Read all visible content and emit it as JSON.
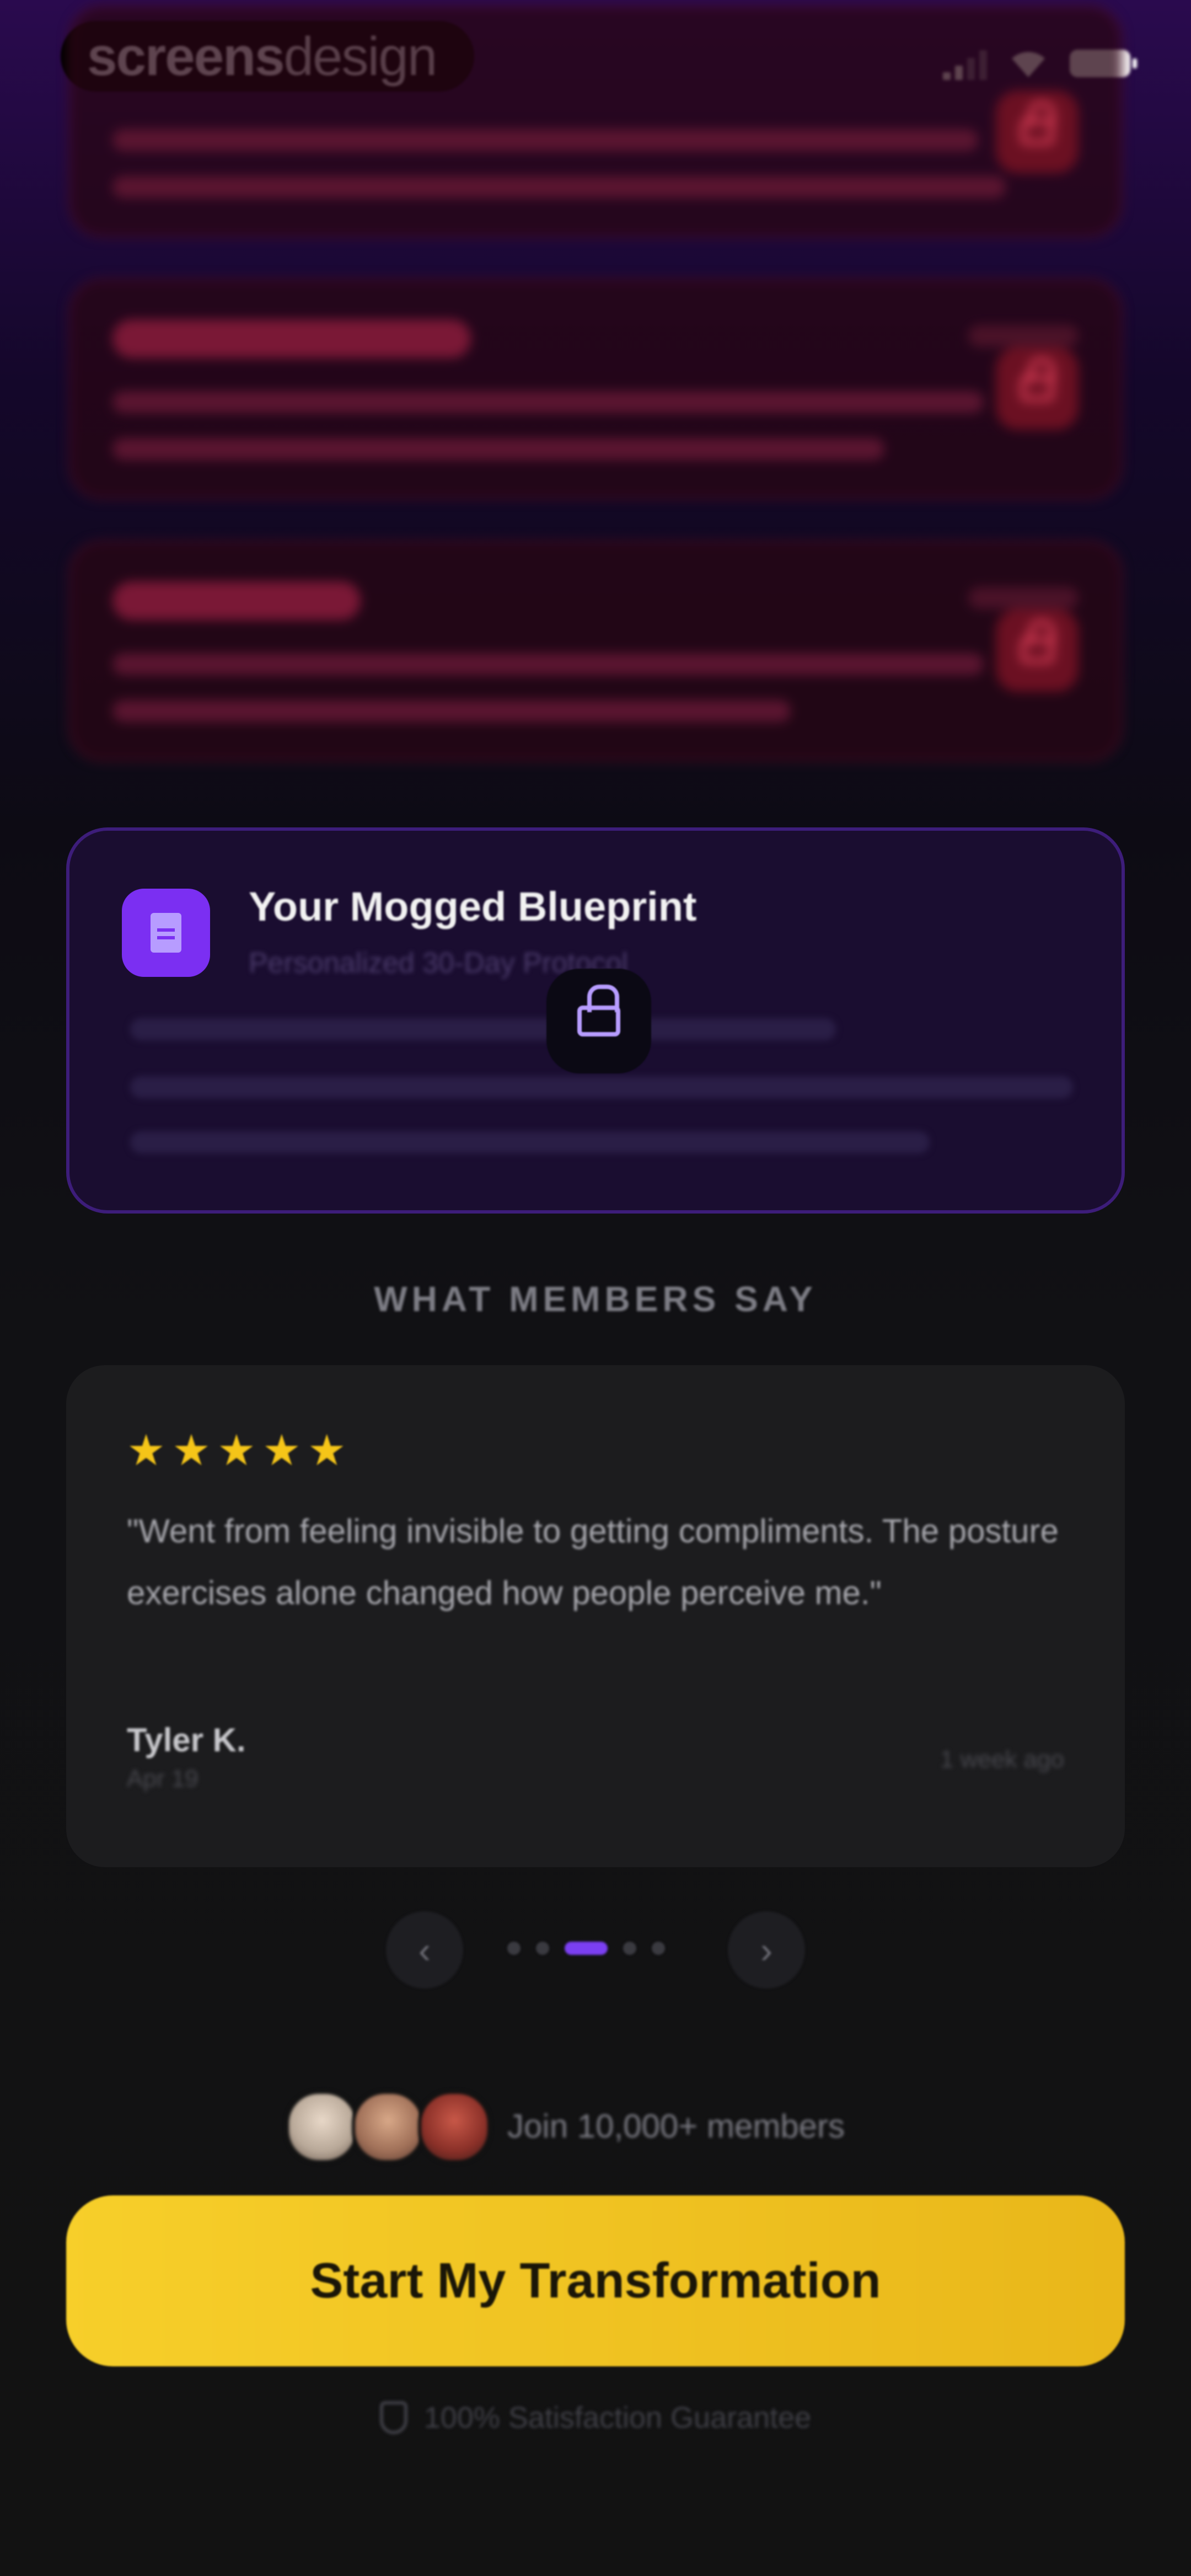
{
  "status_bar": {
    "watermark_bold": "screens",
    "watermark_light": "design"
  },
  "blueprint": {
    "title": "Your Mogged Blueprint",
    "subtitle": "Personalized 30-Day Protocol"
  },
  "testimonials": {
    "heading": "WHAT MEMBERS SAY",
    "rating": 5,
    "quote": "\"Went from feeling invisible to getting compliments. The posture exercises alone changed how people perceive me.\"",
    "reviewer": "Tyler K.",
    "date": "Apr 19",
    "time_ago": "1 week ago",
    "prev_label": "‹",
    "next_label": "›",
    "dots_total": 5,
    "dots_active_index": 2
  },
  "members": {
    "text": "Join 10,000+ members"
  },
  "cta": {
    "label": "Start My Transformation"
  },
  "guarantee": {
    "text": "100% Satisfaction Guarantee"
  },
  "colors": {
    "accent_purple": "#7b2ff2",
    "cta_yellow": "#f7cf2a",
    "star_yellow": "#f5c518",
    "lock_red": "#e0405a"
  }
}
